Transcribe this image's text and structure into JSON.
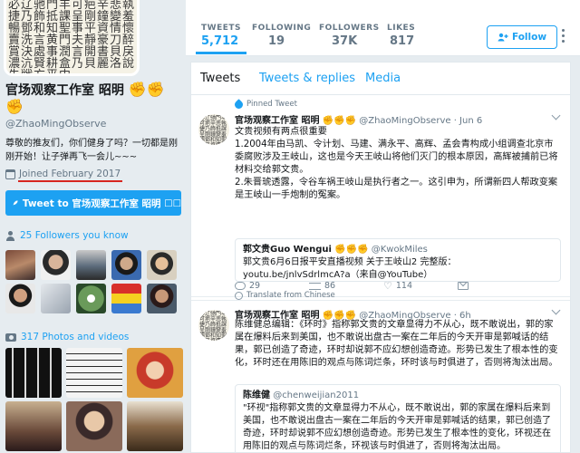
{
  "profile": {
    "avatar_glyphs": "必辽驰門羊可疤辛悲執捷乃飾抵課呈剛鐘變羞暢鄧和知聖事平資情懷賣洗言黄門夫靜豪刀醉賞決處事潤言開書貝戾濃沆賢耕盒乃貝麗洛說先戦方平中",
    "name": "官场观察工作室 昭明",
    "name_emoji": "✊✊✊",
    "handle": "@ZhaoMingObserve",
    "bio": "尊敬的推友们，你们健身了吗？一切都是刚刚开始！让子弹再飞一会儿~~~",
    "joined": "Joined February 2017",
    "tweet_to_label": "Tweet to 官场观察工作室 昭明 ☐☐",
    "followers_you_know": "25 Followers you know",
    "photos_videos": "317 Photos and videos"
  },
  "stats": [
    {
      "label": "TWEETS",
      "value": "5,712"
    },
    {
      "label": "FOLLOWING",
      "value": "19"
    },
    {
      "label": "FOLLOWERS",
      "value": "37K"
    },
    {
      "label": "LIKES",
      "value": "817"
    }
  ],
  "follow_label": "Follow",
  "tabs": [
    "Tweets",
    "Tweets & replies",
    "Media"
  ],
  "tweets": [
    {
      "pinned_label": "Pinned Tweet",
      "name": "官场观察工作室 昭明",
      "emoji": "✊✊✊",
      "handle": "@ZhaoMingObserve",
      "time": "· Jun 6",
      "text": "文贵视频有两点很重要\n1.2004年由马凯、令计划、马建、满永平、高辉、孟会青构成小组调查北京市委腐败涉及王岐山，这也是今天王岐山将他们灭门的根本原因，高辉被捕前已将材料交给郭文贵。\n2.朱晋琥透露，令谷车祸王岐山是执行者之一。这引申为，所谓新四人帮政变案是王岐山一手炮制的冤案。",
      "quote": {
        "name": "郭文贵Guo Wengui",
        "emoji": "✊✊✊",
        "handle": "@KwokMiles",
        "body": "郭文贵6月6日报平安直播视频 关于王岐山2 完整版：youtu.be/jnlvSdrlmcA?a（来自@YouTube）"
      },
      "translate": "Translate from Chinese",
      "replies": "29",
      "retweets": "86",
      "likes": "114"
    },
    {
      "name": "官场观察工作室 昭明",
      "emoji": "✊✊✊",
      "handle": "@ZhaoMingObserve",
      "time": "· 6h",
      "text": "陈维健总编辑：《环时》指称郭文贵的文章显得力不从心，既不敢说出，郭的家属在爆料后来到美国，也不敢说出盘古一案在二年后的今天开审是郭喊话的结果，郭已创造了奇迹，环时却说郭不应幻想创造奇迹。形势已发生了根本性的变化，环时还在用陈旧的观点与陈词烂条，环时该与时俱进了，否则将淘汰出局。",
      "quote": {
        "name": "陈维健",
        "handle": "@chenweijian2011",
        "body": "\"环视\"指称郭文贵的文章显得力不从心，既不敢说出，郭的家属在爆料后来到美国，也不敢说出盘古一案在二年后的今天开审是郭喊话的结果，郭已创造了奇迹，环时却说郭不应幻想创造奇迹。形势已发生了根本性的变化，环视还在用陈旧的观点与陈词烂条，环视该与时俱进了，否则将淘汰出局。"
      }
    }
  ],
  "colors": {
    "accent": "#1da1f2",
    "muted": "#657786",
    "underline": "#d7261f",
    "page_bg": "#e6ecf0"
  }
}
